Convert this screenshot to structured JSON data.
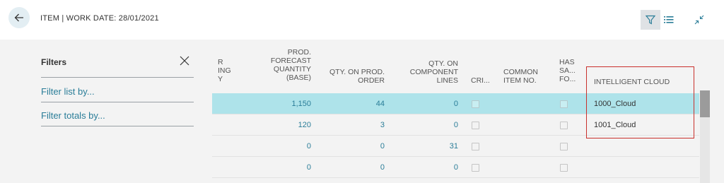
{
  "header": {
    "title": "ITEM | WORK DATE: 28/01/2021"
  },
  "icons": {
    "back": "arrow-left-icon",
    "filter": "funnel-icon",
    "list": "list-icon",
    "collapse": "collapse-arrows-icon",
    "close": "close-icon"
  },
  "filter_pane": {
    "title": "Filters",
    "filter_list_label": "Filter list by...",
    "filter_totals_label": "Filter totals by..."
  },
  "columns": {
    "partial_line1": "R",
    "partial_line2": "ING",
    "partial_line3": "Y",
    "prod_forecast_l1": "PROD.",
    "prod_forecast_l2": "FORECAST",
    "prod_forecast_l3": "QUANTITY",
    "prod_forecast_l4": "(BASE)",
    "qty_prod_order": "QTY. ON PROD.",
    "qty_prod_order_l2": "ORDER",
    "qty_component_l1": "QTY. ON",
    "qty_component_l2": "COMPONENT",
    "qty_component_l3": "LINES",
    "critical": "CRI...",
    "common_l1": "COMMON",
    "common_l2": "ITEM NO.",
    "has_l1": "HAS",
    "has_l2": "SA...",
    "has_l3": "FO...",
    "intelligent_cloud": "INTELLIGENT CLOUD"
  },
  "rows": [
    {
      "prod_forecast": "1,150",
      "qty_prod_order": "44",
      "qty_component": "0",
      "cloud": "1000_Cloud",
      "selected": true
    },
    {
      "prod_forecast": "120",
      "qty_prod_order": "3",
      "qty_component": "0",
      "cloud": "1001_Cloud",
      "selected": false
    },
    {
      "prod_forecast": "0",
      "qty_prod_order": "0",
      "qty_component": "31",
      "cloud": "",
      "selected": false
    },
    {
      "prod_forecast": "0",
      "qty_prod_order": "0",
      "qty_component": "0",
      "cloud": "",
      "selected": false
    }
  ],
  "colors": {
    "accent": "#2a7d98",
    "selected_row": "#aee3ea",
    "highlight_border": "#c9302c"
  }
}
